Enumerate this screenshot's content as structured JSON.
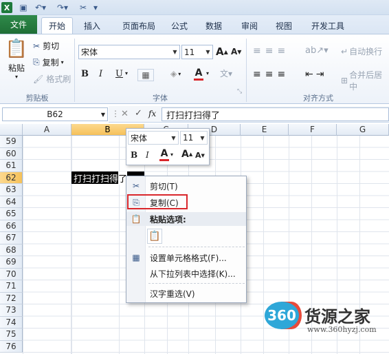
{
  "qat": {
    "undo_icon": "undo-icon",
    "redo_icon": "redo-icon"
  },
  "tabs": [
    {
      "label": "文件"
    },
    {
      "label": "开始"
    },
    {
      "label": "插入"
    },
    {
      "label": "页面布局"
    },
    {
      "label": "公式"
    },
    {
      "label": "数据"
    },
    {
      "label": "审阅"
    },
    {
      "label": "视图"
    },
    {
      "label": "开发工具"
    }
  ],
  "ribbon": {
    "clipboard": {
      "paste": "粘贴",
      "cut": "剪切",
      "copy": "复制",
      "format_painter": "格式刷",
      "group": "剪贴板"
    },
    "font": {
      "name": "宋体",
      "size": "11",
      "grow": "A",
      "shrink": "A",
      "bold": "B",
      "italic": "I",
      "underline": "U",
      "font_color": "A",
      "group": "字体"
    },
    "alignment": {
      "wrap": "自动换行",
      "merge": "合并后居中",
      "group": "对齐方式"
    }
  },
  "formula_bar": {
    "name_box": "B62",
    "fx": "fx",
    "content": "打扫打扫得了"
  },
  "columns": [
    "A",
    "B",
    "C",
    "D",
    "E",
    "F",
    "G"
  ],
  "rows": [
    "59",
    "60",
    "61",
    "62",
    "63",
    "64",
    "65",
    "66",
    "67",
    "68",
    "69",
    "70",
    "71",
    "72",
    "73",
    "74",
    "75",
    "76"
  ],
  "cell": {
    "text": "打扫打扫得",
    "tail": "了"
  },
  "mini_toolbar": {
    "font": "宋体",
    "size": "11",
    "bold": "B",
    "italic": "I",
    "color": "A",
    "grow": "A",
    "shrink": "A"
  },
  "context_menu": {
    "cut": "剪切(T)",
    "copy": "复制(C)",
    "paste_header": "粘贴选项:",
    "format_cells": "设置单元格格式(F)...",
    "pick_from_list": "从下拉列表中选择(K)...",
    "hanzi_reselect": "汉字重选(V)"
  },
  "watermark": {
    "badge": "360",
    "brand": "货源之家",
    "url": "www.360hyzj.com"
  },
  "colors": {
    "file_tab": "#1f6e36",
    "highlight": "#f6c15a",
    "red_box": "#d9262b",
    "font_red": "#d9262b"
  }
}
